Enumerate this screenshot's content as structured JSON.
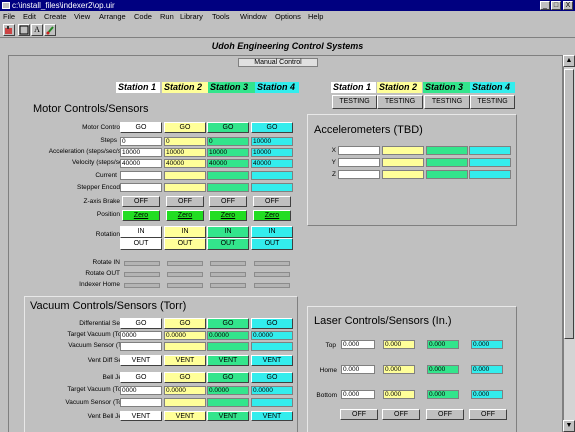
{
  "window": {
    "title": "c:\\install_files\\indexer2\\op.uir",
    "min": "_",
    "max": "□",
    "close": "X"
  },
  "menu": [
    "File",
    "Edit",
    "Create",
    "View",
    "Arrange",
    "Code",
    "Run",
    "Library",
    "Tools",
    "Window",
    "Options",
    "Help"
  ],
  "toolbar": {
    "text_tool": "A"
  },
  "app_title": "Udoh Engineering Control Systems",
  "panel_label": "Manual Control",
  "stations": [
    "Station 1",
    "Station 2",
    "Station 3",
    "Station 4"
  ],
  "testing": [
    "TESTING",
    "TESTING",
    "TESTING",
    "TESTING"
  ],
  "motor": {
    "title": "Motor Controls/Sensors",
    "labels": {
      "motor_control": "Motor Contro",
      "steps": "Steps",
      "accel": "Acceleration (steps/sec/sec)",
      "velocity": "Velocity (steps/sec)",
      "current": "Current",
      "encoder": "Stepper Encod",
      "brake": "Z-axis Brake",
      "position": "Position",
      "rotation": "Rotation",
      "rotate_in": "Rotate IN",
      "rotate_out": "Rotate OUT",
      "indexer_home": "Indexer Home"
    },
    "go": [
      "GO",
      "GO",
      "GO",
      "GO"
    ],
    "steps": [
      "0",
      "0",
      "0",
      "10000"
    ],
    "accel": [
      "10000",
      "10000",
      "10000",
      "10000"
    ],
    "velocity": [
      "40000",
      "40000",
      "40000",
      "40000"
    ],
    "brake": [
      "OFF",
      "OFF",
      "OFF",
      "OFF"
    ],
    "zero": [
      "Zero",
      "Zero",
      "Zero",
      "Zero"
    ],
    "rot_in": [
      "IN",
      "IN",
      "IN",
      "IN"
    ],
    "rot_out": [
      "OUT",
      "OUT",
      "OUT",
      "OUT"
    ]
  },
  "vacuum": {
    "title": "Vacuum Controls/Sensors (Torr)",
    "labels": {
      "diff": "Differential Se",
      "target1": "Target Vacuum (Torr)",
      "sensor1": "Vacuum Sensor (T",
      "vent_diff": "Vent Diff Se",
      "bell": "Bell Je",
      "target2": "Target Vacuum (Torr)",
      "sensor2": "Vacuum Sensor (To",
      "vent_bell": "Vent Bell Je"
    },
    "go1": [
      "GO",
      "GO",
      "GO",
      "GO"
    ],
    "target1": [
      "0000",
      "0.0000",
      "0.0000",
      "0.0000"
    ],
    "vent1": [
      "VENT",
      "VENT",
      "VENT",
      "VENT"
    ],
    "go2": [
      "GO",
      "GO",
      "GO",
      "GO"
    ],
    "target2": [
      "0000",
      "0.0000",
      "0.0000",
      "0.0000"
    ],
    "vent2": [
      "VENT",
      "VENT",
      "VENT",
      "VENT"
    ]
  },
  "accel_panel": {
    "title": "Accelerometers (TBD)",
    "axes": [
      "X",
      "Y",
      "Z"
    ]
  },
  "laser": {
    "title": "Laser Controls/Sensors (In.)",
    "rows": [
      {
        "label": "Top",
        "values": [
          "0.000",
          "0.000",
          "0.000",
          "0.000"
        ]
      },
      {
        "label": "Home",
        "values": [
          "0.000",
          "0.000",
          "0.000",
          "0.000"
        ]
      },
      {
        "label": "Bottom",
        "values": [
          "0.000",
          "0.000",
          "0.000",
          "0.000"
        ]
      }
    ],
    "off": [
      "OFF",
      "OFF",
      "OFF",
      "OFF"
    ]
  },
  "colors": {
    "s1": "#ffffff",
    "s2": "#ffff99",
    "s3": "#33e58c",
    "s4": "#33eded",
    "zero": "#22dd22",
    "titlebar": "#000080"
  }
}
